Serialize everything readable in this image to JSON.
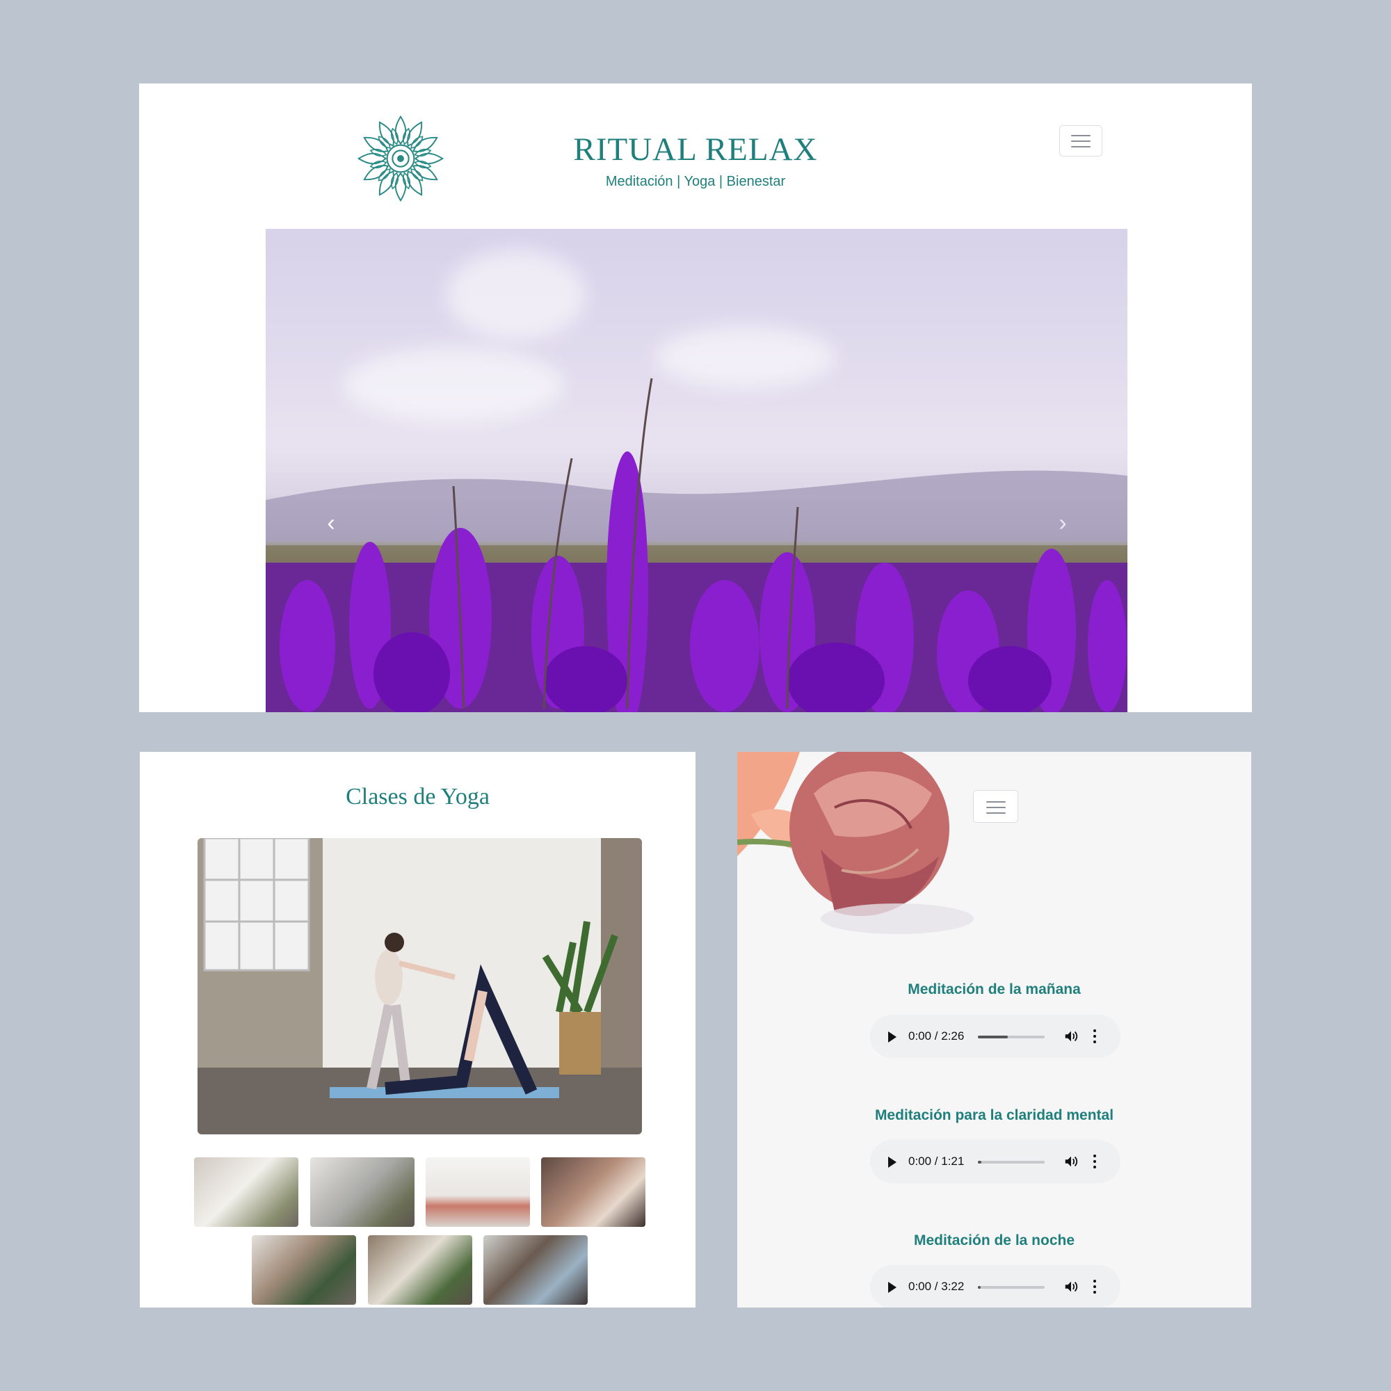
{
  "site": {
    "title": "RITUAL RELAX",
    "subtitle": "Meditación | Yoga | Bienestar"
  },
  "icons": {
    "logo": "mandala-logo",
    "menu": "hamburger-menu-icon",
    "prev": "chevron-left-icon",
    "next": "chevron-right-icon",
    "play": "play-icon",
    "volume": "volume-icon",
    "more": "more-vert-icon"
  },
  "carousel": {
    "prev_glyph": "‹",
    "next_glyph": "›"
  },
  "yoga": {
    "title": "Clases de Yoga",
    "thumbnails_count": 7
  },
  "audio": {
    "tracks": [
      {
        "title": "Meditación de la mañana",
        "time": "0:00 / 2:26",
        "progress": 0.45
      },
      {
        "title": "Meditación para la claridad mental",
        "time": "0:00 / 1:21",
        "progress": 0.05
      },
      {
        "title": "Meditación de la noche",
        "time": "0:00 / 3:22",
        "progress": 0.02
      }
    ]
  },
  "colors": {
    "brand": "#1f7f7c",
    "background": "#bcc4cf"
  }
}
